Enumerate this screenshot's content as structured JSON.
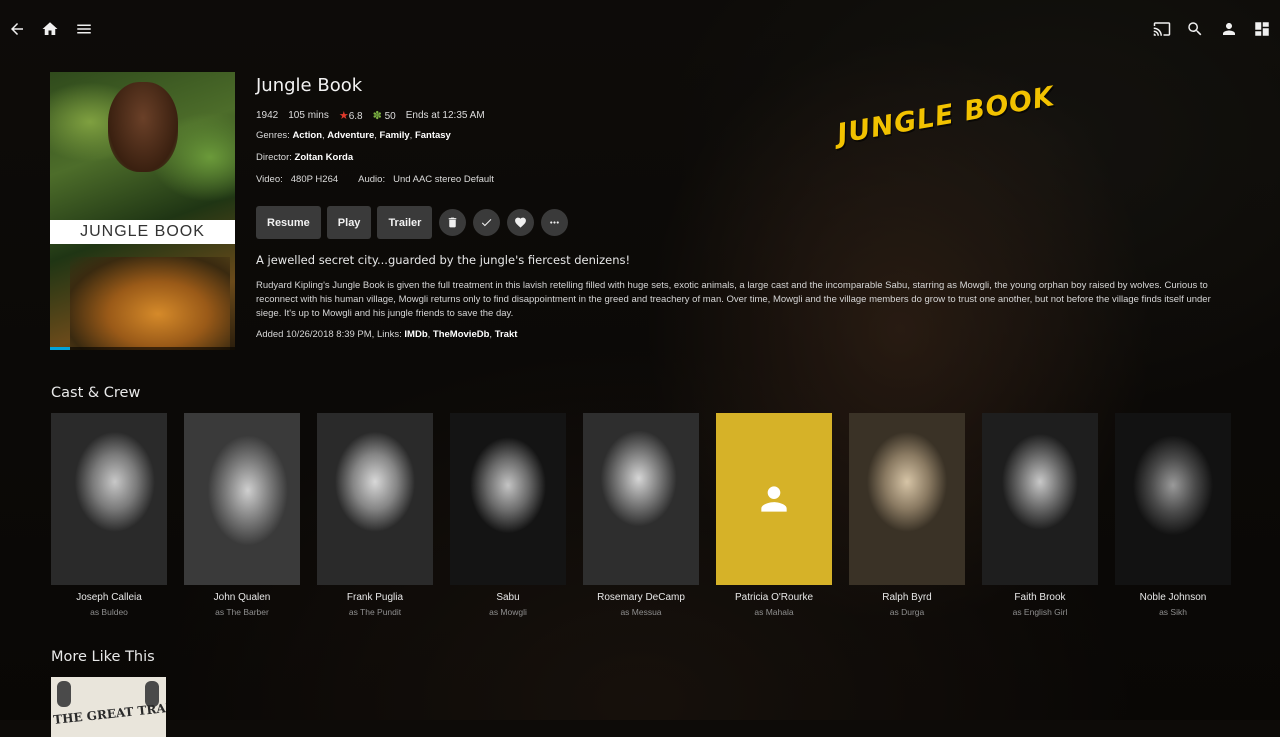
{
  "movie": {
    "title": "Jungle Book",
    "year": "1942",
    "runtime": "105 mins",
    "community_rating": "6.8",
    "critic_rating": "50",
    "ends_at": "Ends at 12:35 AM",
    "genres_label": "Genres:",
    "genres": [
      "Action",
      "Adventure",
      "Family",
      "Fantasy"
    ],
    "director_label": "Director:",
    "director": "Zoltan Korda",
    "video_label": "Video:",
    "video": "480P H264",
    "audio_label": "Audio:",
    "audio": "Und AAC stereo Default",
    "tagline": "A jewelled secret city...guarded by the jungle's fiercest denizens!",
    "overview": "Rudyard Kipling's Jungle Book is given the full treatment in this lavish retelling filled with huge sets, exotic animals, a large cast and the incomparable Sabu, starring as Mowgli, the young orphan boy raised by wolves. Curious to reconnect with his human village, Mowgli returns only to find disappointment in the greed and treachery of man. Over time, Mowgli and the village members do grow to trust one another, but not before the village finds itself under siege. It's up to Mowgli and his jungle friends to save the day.",
    "added_text": "Added 10/26/2018 8:39 PM, Links:",
    "links": [
      "IMDb",
      "TheMovieDb",
      "Trakt"
    ],
    "logo_text": "JUNGLE BOOK",
    "poster_title": "JUNGLE BOOK",
    "watch_progress": 0.11
  },
  "actions": {
    "resume": "Resume",
    "play": "Play",
    "trailer": "Trailer"
  },
  "icons": {
    "back": "back-arrow-icon",
    "home": "home-icon",
    "menu": "menu-icon",
    "cast": "cast-icon",
    "search": "search-icon",
    "user": "user-icon",
    "dashboard": "dashboard-icon",
    "delete": "trash-icon",
    "played": "check-icon",
    "favorite": "heart-icon",
    "more": "more-icon"
  },
  "sections": {
    "cast_title": "Cast & Crew",
    "more_title": "More Like This"
  },
  "cast": [
    {
      "name": "Joseph Calleia",
      "role": "as Buldeo"
    },
    {
      "name": "John Qualen",
      "role": "as The Barber"
    },
    {
      "name": "Frank Puglia",
      "role": "as The Pundit"
    },
    {
      "name": "Sabu",
      "role": "as Mowgli"
    },
    {
      "name": "Rosemary DeCamp",
      "role": "as Messua"
    },
    {
      "name": "Patricia O'Rourke",
      "role": "as Mahala"
    },
    {
      "name": "Ralph Byrd",
      "role": "as Durga"
    },
    {
      "name": "Faith Brook",
      "role": "as English Girl"
    },
    {
      "name": "Noble Johnson",
      "role": "as Sikh"
    }
  ],
  "similar": [
    {
      "title": "THE GREAT TRAIL"
    }
  ],
  "colors": {
    "accent": "#00a4dc",
    "star": "#e0392b",
    "tomato": "#7cb342",
    "placeholder": "#d6b228"
  }
}
